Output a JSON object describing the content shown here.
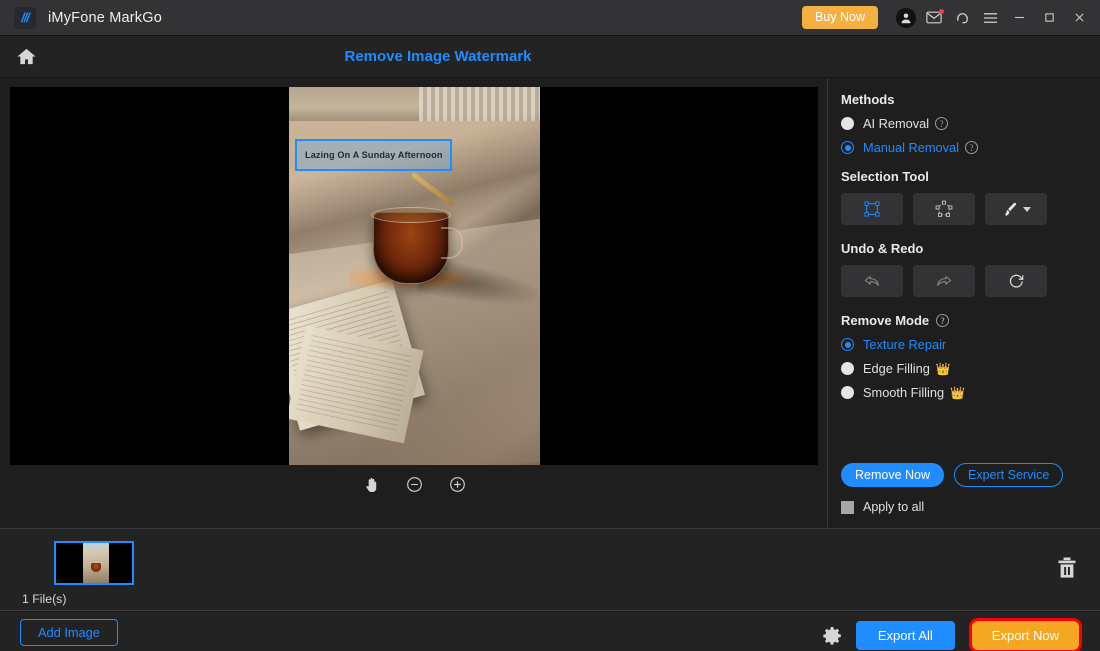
{
  "titlebar": {
    "app_name": "iMyFone MarkGo",
    "logo_icon": "markgo-logo-icon",
    "buy_now_label": "Buy Now",
    "icons": [
      "account-icon",
      "mail-icon",
      "support-headset-icon",
      "hamburger-menu-icon",
      "minimize-icon",
      "maximize-icon",
      "close-icon"
    ],
    "has_mail_notification": true
  },
  "header": {
    "home_icon": "home-icon",
    "title": "Remove Image Watermark",
    "title_color": "#1f8cff"
  },
  "canvas": {
    "watermark_text": "Lazing On A Sunday Afternoon",
    "selection_color": "#1f8cff",
    "background": "#000000",
    "zoom_tools": [
      {
        "name": "pan-hand-tool",
        "label": "pan"
      },
      {
        "name": "zoom-out-button",
        "label": "zoom out"
      },
      {
        "name": "zoom-in-button",
        "label": "zoom in"
      }
    ]
  },
  "sidebar": {
    "methods": {
      "title": "Methods",
      "options": [
        {
          "label": "AI Removal",
          "selected": false,
          "has_help": true
        },
        {
          "label": "Manual Removal",
          "selected": true,
          "has_help": true
        }
      ]
    },
    "selection_tool": {
      "title": "Selection Tool",
      "tools": [
        {
          "name": "rectangle-select-tool",
          "active": true
        },
        {
          "name": "polygon-select-tool",
          "active": false
        },
        {
          "name": "brush-select-tool",
          "active": false,
          "has_dropdown": true
        }
      ]
    },
    "undo_redo": {
      "title": "Undo & Redo",
      "buttons": [
        {
          "name": "undo-button",
          "enabled": false
        },
        {
          "name": "redo-button",
          "enabled": false
        },
        {
          "name": "reset-button",
          "enabled": true
        }
      ]
    },
    "remove_mode": {
      "title": "Remove Mode",
      "has_help": true,
      "options": [
        {
          "label": "Texture Repair",
          "selected": true,
          "premium": false
        },
        {
          "label": "Edge Filling",
          "selected": false,
          "premium": true
        },
        {
          "label": "Smooth Filling",
          "selected": false,
          "premium": true
        }
      ]
    },
    "actions": {
      "remove_now_label": "Remove Now",
      "expert_service_label": "Expert Service",
      "apply_to_all_label": "Apply to all",
      "apply_to_all_checked": false
    }
  },
  "filestrip": {
    "file_count_label": "1 File(s)",
    "thumbnail_selected": true,
    "delete_icon": "trash-icon"
  },
  "bottombar": {
    "add_image_label": "Add Image",
    "settings_icon": "gear-icon",
    "export_all_label": "Export All",
    "export_now_label": "Export Now",
    "export_now_highlight_color": "#ff0000"
  },
  "colors": {
    "accent_blue": "#1f8cff",
    "accent_orange": "#f5a623",
    "buy_now_amber": "#f5b042",
    "premium_gold": "#f0a81e",
    "titlebar_bg": "#333335",
    "panel_bg": "#1e1e1e",
    "strip_bg": "#232323"
  }
}
